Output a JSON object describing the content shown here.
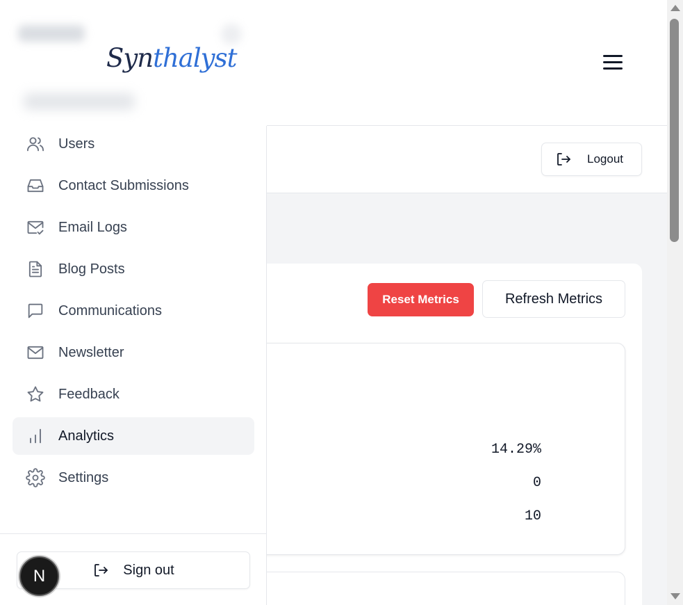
{
  "brand": {
    "logo_part1": "Syn",
    "logo_part2": "thalyst",
    "accent_color": "#2f6fd6"
  },
  "header": {
    "logout_label": "Logout"
  },
  "metrics": {
    "reset_label": "Reset Metrics",
    "refresh_label": "Refresh Metrics",
    "reset_color": "#ef4444",
    "values": [
      "14.29%",
      "0",
      "10"
    ]
  },
  "sidebar": {
    "items": [
      {
        "label": "Users",
        "icon": "users-icon"
      },
      {
        "label": "Contact Submissions",
        "icon": "inbox-icon"
      },
      {
        "label": "Email Logs",
        "icon": "mail-check-icon"
      },
      {
        "label": "Blog Posts",
        "icon": "file-text-icon"
      },
      {
        "label": "Communications",
        "icon": "message-square-icon"
      },
      {
        "label": "Newsletter",
        "icon": "mail-icon"
      },
      {
        "label": "Feedback",
        "icon": "star-icon"
      },
      {
        "label": "Analytics",
        "icon": "bar-chart-icon",
        "active": true
      },
      {
        "label": "Settings",
        "icon": "settings-icon"
      }
    ],
    "signout_label": "Sign out"
  },
  "badge": {
    "letter": "N"
  }
}
